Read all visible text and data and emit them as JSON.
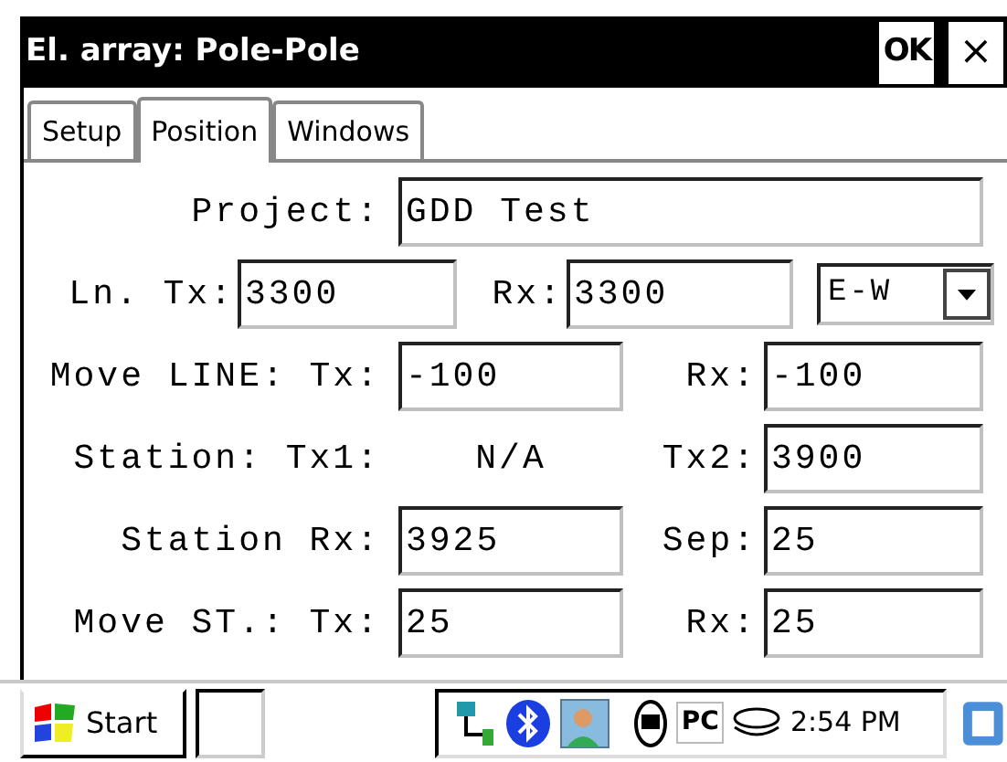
{
  "window": {
    "title": "El. array: Pole-Pole",
    "ok_button": "OK",
    "close_button": "×"
  },
  "tabs": [
    {
      "label": "Setup",
      "selected": false
    },
    {
      "label": "Position",
      "selected": true
    },
    {
      "label": "Windows",
      "selected": false
    }
  ],
  "form": {
    "project": {
      "label": "Project:",
      "value": "GDD Test"
    },
    "line": {
      "tx_label": "Ln. Tx:",
      "tx_value": "3300",
      "rx_label": "Rx:",
      "rx_value": "3300",
      "direction": "E-W"
    },
    "rows": [
      {
        "kind": "fields",
        "label": "Move LINE: Tx:",
        "value_1": "-100",
        "label_2": "Rx:",
        "value_2": "-100"
      },
      {
        "kind": "readout",
        "label": "Station: Tx1:",
        "value_1": "N/A",
        "label_2": "Tx2:",
        "value_2": "3900"
      },
      {
        "kind": "fields",
        "label": "Station Rx:",
        "value_1": "3925",
        "label_2": "Sep:",
        "value_2": "25"
      },
      {
        "kind": "fields",
        "label": "Move ST.: Tx:",
        "value_1": "25",
        "label_2": "Rx:",
        "value_2": "25"
      }
    ]
  },
  "taskbar": {
    "start": "Start",
    "tray_texts": [
      "PC"
    ],
    "clock": "2:54 PM"
  }
}
